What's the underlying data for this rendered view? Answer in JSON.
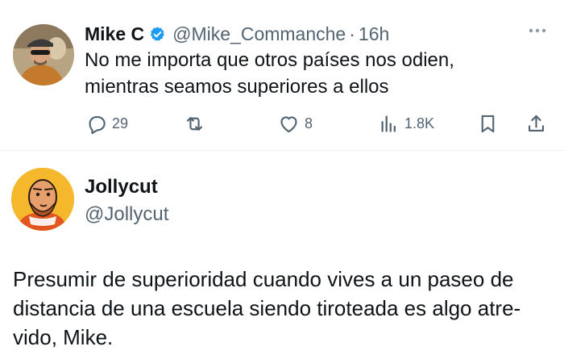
{
  "tweet": {
    "author_name": "Mike C",
    "handle": "@Mike_Commanche",
    "separator": "·",
    "time": "16h",
    "text_line1": "No me importa que otros países nos odien,",
    "text_line2": "mientras seamos superiores a ellos",
    "replies": "29",
    "likes": "8",
    "views": "1.8K",
    "verified_color": "#1d9bf0"
  },
  "reply": {
    "author_name": "Jollycut",
    "handle": "@Jollycut",
    "text_line1": "Presumir de superioridad cuando vives a un paseo de",
    "text_line2": "distancia de una escuela siendo tiroteada es algo atre-",
    "text_line3": "vido, Mike."
  }
}
